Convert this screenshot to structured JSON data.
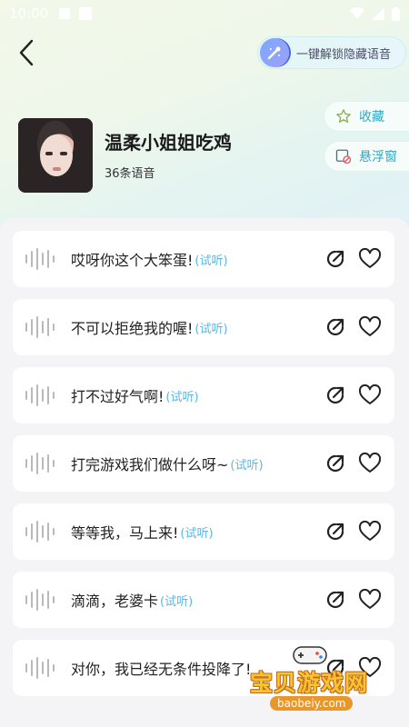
{
  "status_bar": {
    "time": "10:00"
  },
  "header": {
    "unlock_label": "一键解锁隐藏语音"
  },
  "side_buttons": {
    "favorite_label": "收藏",
    "float_label": "悬浮窗"
  },
  "profile": {
    "name": "温柔小姐姐吃鸡",
    "count": "36条语音"
  },
  "voice_items": [
    {
      "text": "哎呀你这个大笨蛋!",
      "trial": "(试听)"
    },
    {
      "text": "不可以拒绝我的喔!",
      "trial": "(试听)"
    },
    {
      "text": "打不过好气啊!",
      "trial": "(试听)"
    },
    {
      "text": "打完游戏我们做什么呀~",
      "trial": "(试听)"
    },
    {
      "text": "等等我，马上来!",
      "trial": "(试听)"
    },
    {
      "text": "滴滴，老婆卡",
      "trial": "(试听)"
    },
    {
      "text": "对你，我已经无条件投降了!",
      "trial": ""
    }
  ],
  "watermark": {
    "title": "宝贝游戏网",
    "url": "baobeiy.com"
  },
  "colors": {
    "accent": "#2fa7c4",
    "trial": "#5ab7e2"
  }
}
